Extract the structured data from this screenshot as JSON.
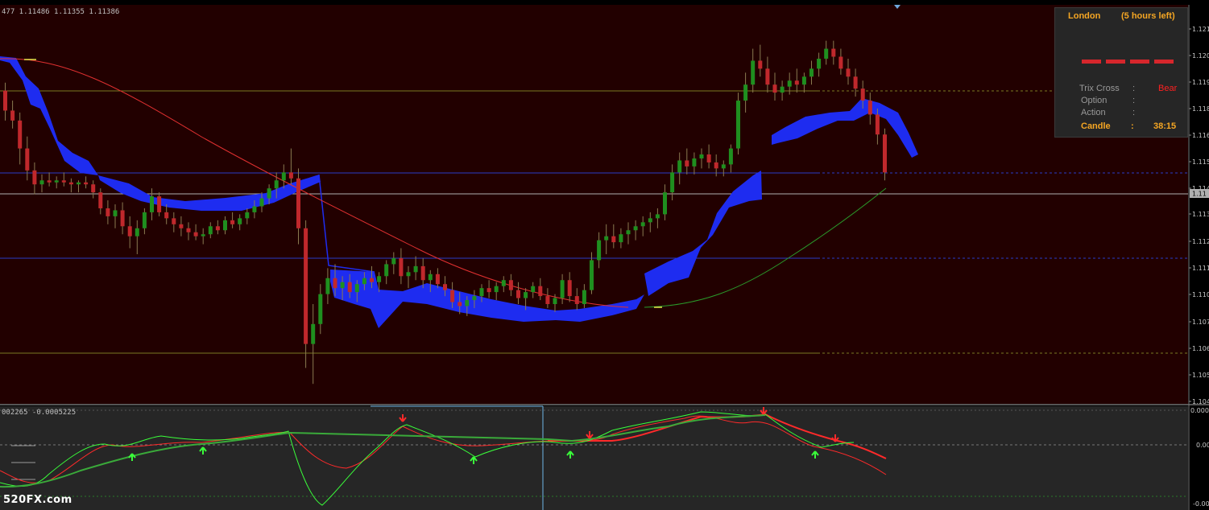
{
  "price_readout": "477 1.11486 1.11355 1.11386",
  "oscillator_readout": "002265 -0.0005225",
  "watermark": "520FX.com",
  "price_axis_labels": [
    "1.121",
    "1.120",
    "1.119",
    "1.118",
    "1.116",
    "1.115",
    "1.114",
    "1.113",
    "1.112",
    "1.111",
    "1.110",
    "1.107",
    "1.106",
    "1.105",
    "1.104"
  ],
  "current_price_tag": "1.11",
  "osc_axis_labels": [
    "0.000",
    "0.00",
    "-0.00"
  ],
  "info_panel": {
    "session": "London",
    "time_left": "(5 hours left)",
    "trix_label": "Trix Cross",
    "trix_sep": ":",
    "trix_value": "Bear",
    "option_label": "Option",
    "option_sep": ":",
    "action_label": "Action",
    "action_sep": ":",
    "candle_label": "Candle",
    "candle_sep": ":",
    "candle_value": "38:15"
  },
  "colors": {
    "chart_bg": "#220000",
    "osc_bg": "#262626",
    "bull": "#1f8f1f",
    "bear": "#c0282c",
    "cloud": "#1e2cf0",
    "ma_red": "#e03030",
    "ma_green": "#2a9a2a",
    "hline_blue": "#2a3dc8",
    "hline_olive": "#7a7a22",
    "hline_grey": "#b0b0b0"
  },
  "chart_data": {
    "type": "candlestick",
    "note_sr_levels": [
      1.119,
      1.114,
      1.1127,
      1.1105,
      1.107
    ],
    "candles": [
      [
        1.1187,
        1.1191,
        1.1172,
        1.1177
      ],
      [
        1.1177,
        1.1182,
        1.1168,
        1.1172
      ],
      [
        1.1172,
        1.1176,
        1.115,
        1.1158
      ],
      [
        1.1158,
        1.1164,
        1.1142,
        1.1147
      ],
      [
        1.1147,
        1.1151,
        1.1135,
        1.114
      ],
      [
        1.114,
        1.1145,
        1.1136,
        1.1142
      ],
      [
        1.1142,
        1.1146,
        1.1139,
        1.1141
      ],
      [
        1.1141,
        1.1144,
        1.1138,
        1.1142
      ],
      [
        1.1142,
        1.1146,
        1.1139,
        1.1141
      ],
      [
        1.1141,
        1.1143,
        1.1136,
        1.114
      ],
      [
        1.114,
        1.1142,
        1.1136,
        1.1141
      ],
      [
        1.1141,
        1.1144,
        1.1138,
        1.114
      ],
      [
        1.114,
        1.1142,
        1.1133,
        1.1136
      ],
      [
        1.1136,
        1.1138,
        1.1125,
        1.1128
      ],
      [
        1.1128,
        1.1132,
        1.112,
        1.1124
      ],
      [
        1.1124,
        1.113,
        1.1118,
        1.1127
      ],
      [
        1.1127,
        1.1131,
        1.1115,
        1.1119
      ],
      [
        1.1119,
        1.1124,
        1.1108,
        1.1114
      ],
      [
        1.1114,
        1.1122,
        1.1105,
        1.1118
      ],
      [
        1.1118,
        1.1128,
        1.1115,
        1.1126
      ],
      [
        1.1126,
        1.1138,
        1.1122,
        1.1134
      ],
      [
        1.1134,
        1.1136,
        1.1124,
        1.1126
      ],
      [
        1.1126,
        1.113,
        1.112,
        1.1123
      ],
      [
        1.1123,
        1.1126,
        1.1116,
        1.112
      ],
      [
        1.112,
        1.1124,
        1.1114,
        1.1118
      ],
      [
        1.1118,
        1.1121,
        1.1112,
        1.1116
      ],
      [
        1.1116,
        1.112,
        1.1112,
        1.1114
      ],
      [
        1.1114,
        1.1118,
        1.111,
        1.1115
      ],
      [
        1.1115,
        1.1121,
        1.1113,
        1.1119
      ],
      [
        1.1119,
        1.1122,
        1.1115,
        1.1117
      ],
      [
        1.1117,
        1.1124,
        1.1115,
        1.1122
      ],
      [
        1.1122,
        1.1126,
        1.1118,
        1.112
      ],
      [
        1.112,
        1.1125,
        1.1117,
        1.1123
      ],
      [
        1.1123,
        1.1128,
        1.112,
        1.1126
      ],
      [
        1.1126,
        1.1132,
        1.1123,
        1.1129
      ],
      [
        1.1129,
        1.1136,
        1.1126,
        1.1133
      ],
      [
        1.1133,
        1.114,
        1.113,
        1.1138
      ],
      [
        1.1138,
        1.1146,
        1.1133,
        1.1142
      ],
      [
        1.1142,
        1.115,
        1.1138,
        1.1146
      ],
      [
        1.1146,
        1.1158,
        1.114,
        1.1143
      ],
      [
        1.1143,
        1.1148,
        1.111,
        1.1118
      ],
      [
        1.1118,
        1.1122,
        1.1048,
        1.106
      ],
      [
        1.106,
        1.108,
        1.104,
        1.107
      ],
      [
        1.107,
        1.109,
        1.1065,
        1.1085
      ],
      [
        1.1085,
        1.1098,
        1.108,
        1.1093
      ],
      [
        1.1093,
        1.11,
        1.1084,
        1.1088
      ],
      [
        1.1088,
        1.1094,
        1.1082,
        1.1091
      ],
      [
        1.1091,
        1.1095,
        1.1083,
        1.1086
      ],
      [
        1.1086,
        1.1092,
        1.1081,
        1.109
      ],
      [
        1.109,
        1.1096,
        1.1087,
        1.1093
      ],
      [
        1.1093,
        1.1099,
        1.1088,
        1.1091
      ],
      [
        1.1091,
        1.1096,
        1.1086,
        1.1094
      ],
      [
        1.1094,
        1.1102,
        1.109,
        1.11
      ],
      [
        1.11,
        1.1106,
        1.1095,
        1.1103
      ],
      [
        1.1103,
        1.1108,
        1.109,
        1.1094
      ],
      [
        1.1094,
        1.1099,
        1.1088,
        1.1096
      ],
      [
        1.1096,
        1.1104,
        1.1092,
        1.1099
      ],
      [
        1.1099,
        1.1103,
        1.1088,
        1.1092
      ],
      [
        1.1092,
        1.1097,
        1.1086,
        1.1095
      ],
      [
        1.1095,
        1.1098,
        1.1088,
        1.109
      ],
      [
        1.109,
        1.1094,
        1.1084,
        1.1087
      ],
      [
        1.1087,
        1.1091,
        1.1078,
        1.1081
      ],
      [
        1.1081,
        1.1086,
        1.1075,
        1.1079
      ],
      [
        1.1079,
        1.1084,
        1.1074,
        1.1082
      ],
      [
        1.1082,
        1.1087,
        1.1078,
        1.1084
      ],
      [
        1.1084,
        1.109,
        1.1081,
        1.1088
      ],
      [
        1.1088,
        1.1092,
        1.1083,
        1.1086
      ],
      [
        1.1086,
        1.1091,
        1.1082,
        1.1089
      ],
      [
        1.1089,
        1.1094,
        1.1086,
        1.1092
      ],
      [
        1.1092,
        1.1095,
        1.1084,
        1.1087
      ],
      [
        1.1087,
        1.1091,
        1.108,
        1.1083
      ],
      [
        1.1083,
        1.1088,
        1.1077,
        1.1086
      ],
      [
        1.1086,
        1.1091,
        1.1083,
        1.1089
      ],
      [
        1.1089,
        1.1093,
        1.1082,
        1.1084
      ],
      [
        1.1084,
        1.1088,
        1.1078,
        1.108
      ],
      [
        1.108,
        1.1085,
        1.1076,
        1.1083
      ],
      [
        1.1083,
        1.1095,
        1.108,
        1.1092
      ],
      [
        1.1092,
        1.1096,
        1.1081,
        1.1084
      ],
      [
        1.1084,
        1.1088,
        1.1077,
        1.108
      ],
      [
        1.108,
        1.109,
        1.1078,
        1.1087
      ],
      [
        1.1087,
        1.1106,
        1.1085,
        1.1102
      ],
      [
        1.1102,
        1.1116,
        1.1098,
        1.1112
      ],
      [
        1.1112,
        1.112,
        1.1105,
        1.1114
      ],
      [
        1.1114,
        1.112,
        1.1108,
        1.1111
      ],
      [
        1.1111,
        1.1118,
        1.1108,
        1.1115
      ],
      [
        1.1115,
        1.1121,
        1.111,
        1.1117
      ],
      [
        1.1117,
        1.1122,
        1.1112,
        1.1119
      ],
      [
        1.1119,
        1.1124,
        1.1114,
        1.1121
      ],
      [
        1.1121,
        1.1126,
        1.1116,
        1.1123
      ],
      [
        1.1123,
        1.1128,
        1.1118,
        1.1125
      ],
      [
        1.1125,
        1.114,
        1.1122,
        1.1136
      ],
      [
        1.1136,
        1.115,
        1.1132,
        1.1146
      ],
      [
        1.1146,
        1.1156,
        1.114,
        1.1152
      ],
      [
        1.1152,
        1.1158,
        1.1145,
        1.1149
      ],
      [
        1.1149,
        1.1156,
        1.1145,
        1.1153
      ],
      [
        1.1153,
        1.1158,
        1.1148,
        1.1155
      ],
      [
        1.1155,
        1.116,
        1.1148,
        1.1151
      ],
      [
        1.1151,
        1.1155,
        1.1144,
        1.1148
      ],
      [
        1.1148,
        1.1152,
        1.1144,
        1.115
      ],
      [
        1.115,
        1.116,
        1.1146,
        1.1158
      ],
      [
        1.1158,
        1.1186,
        1.1155,
        1.1182
      ],
      [
        1.1182,
        1.1196,
        1.1176,
        1.119
      ],
      [
        1.119,
        1.1208,
        1.1186,
        1.1202
      ],
      [
        1.1202,
        1.121,
        1.1194,
        1.1198
      ],
      [
        1.1198,
        1.1204,
        1.1186,
        1.119
      ],
      [
        1.119,
        1.1196,
        1.1182,
        1.1186
      ],
      [
        1.1186,
        1.1192,
        1.1182,
        1.1189
      ],
      [
        1.1189,
        1.1196,
        1.1185,
        1.1192
      ],
      [
        1.1192,
        1.1198,
        1.1186,
        1.119
      ],
      [
        1.119,
        1.1196,
        1.1186,
        1.1194
      ],
      [
        1.1194,
        1.1202,
        1.119,
        1.1198
      ],
      [
        1.1198,
        1.1206,
        1.1194,
        1.1203
      ],
      [
        1.1203,
        1.1212,
        1.12,
        1.1208
      ],
      [
        1.1208,
        1.1212,
        1.12,
        1.1204
      ],
      [
        1.1204,
        1.1208,
        1.1195,
        1.1198
      ],
      [
        1.1198,
        1.1203,
        1.119,
        1.1194
      ],
      [
        1.1194,
        1.1198,
        1.1184,
        1.1188
      ],
      [
        1.1188,
        1.1192,
        1.1178,
        1.1182
      ],
      [
        1.1182,
        1.1186,
        1.117,
        1.1175
      ],
      [
        1.1175,
        1.1178,
        1.116,
        1.1165
      ],
      [
        1.1165,
        1.1168,
        1.1142,
        1.1146
      ]
    ]
  }
}
